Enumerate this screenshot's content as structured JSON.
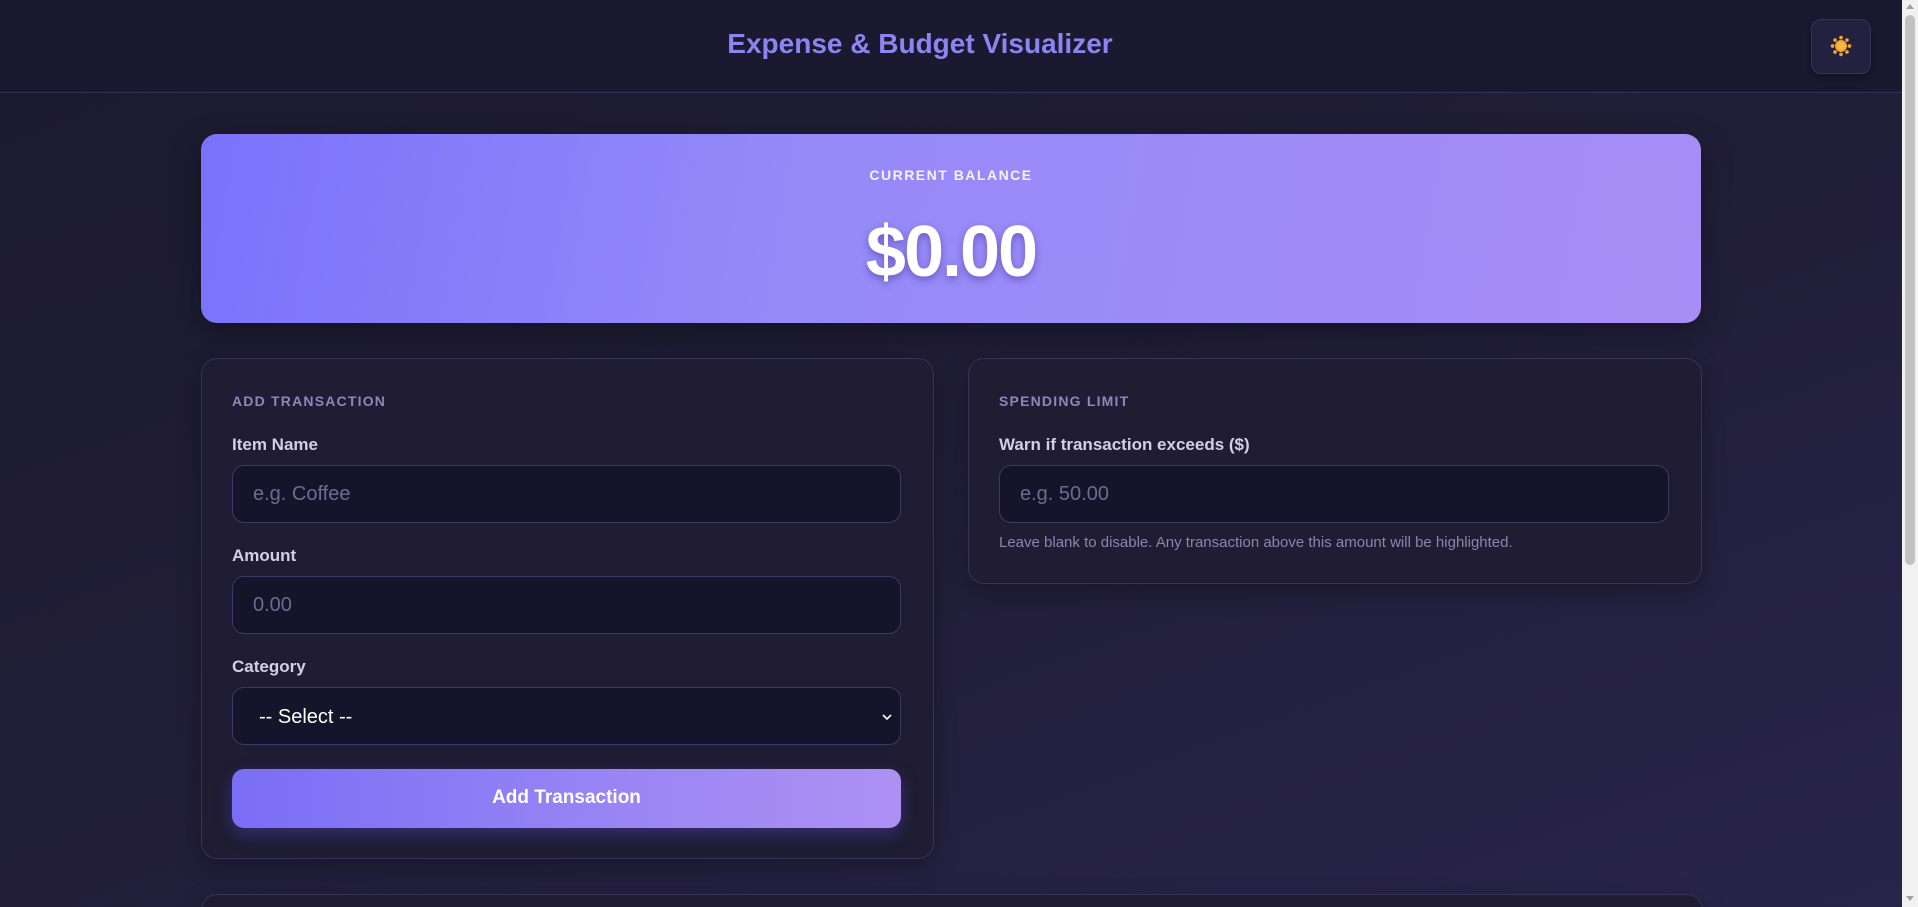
{
  "header": {
    "title": "Expense & Budget Visualizer",
    "theme_toggle_icon": "sun-icon"
  },
  "balance": {
    "label": "CURRENT BALANCE",
    "value": "$0.00"
  },
  "add_transaction": {
    "section_title": "ADD TRANSACTION",
    "item_name": {
      "label": "Item Name",
      "placeholder": "e.g. Coffee",
      "value": ""
    },
    "amount": {
      "label": "Amount",
      "placeholder": "0.00",
      "value": ""
    },
    "category": {
      "label": "Category",
      "selected": "-- Select --"
    },
    "submit_label": "Add Transaction"
  },
  "spending_limit": {
    "section_title": "SPENDING LIMIT",
    "limit_field": {
      "label": "Warn if transaction exceeds ($)",
      "placeholder": "e.g. 50.00",
      "value": ""
    },
    "hint": "Leave blank to disable. Any transaction above this amount will be highlighted."
  },
  "colors": {
    "accent": "#8f83f2",
    "balance_gradient_start": "#7a72fb",
    "balance_gradient_end": "#a78df6",
    "background": "#1c1a2e"
  }
}
